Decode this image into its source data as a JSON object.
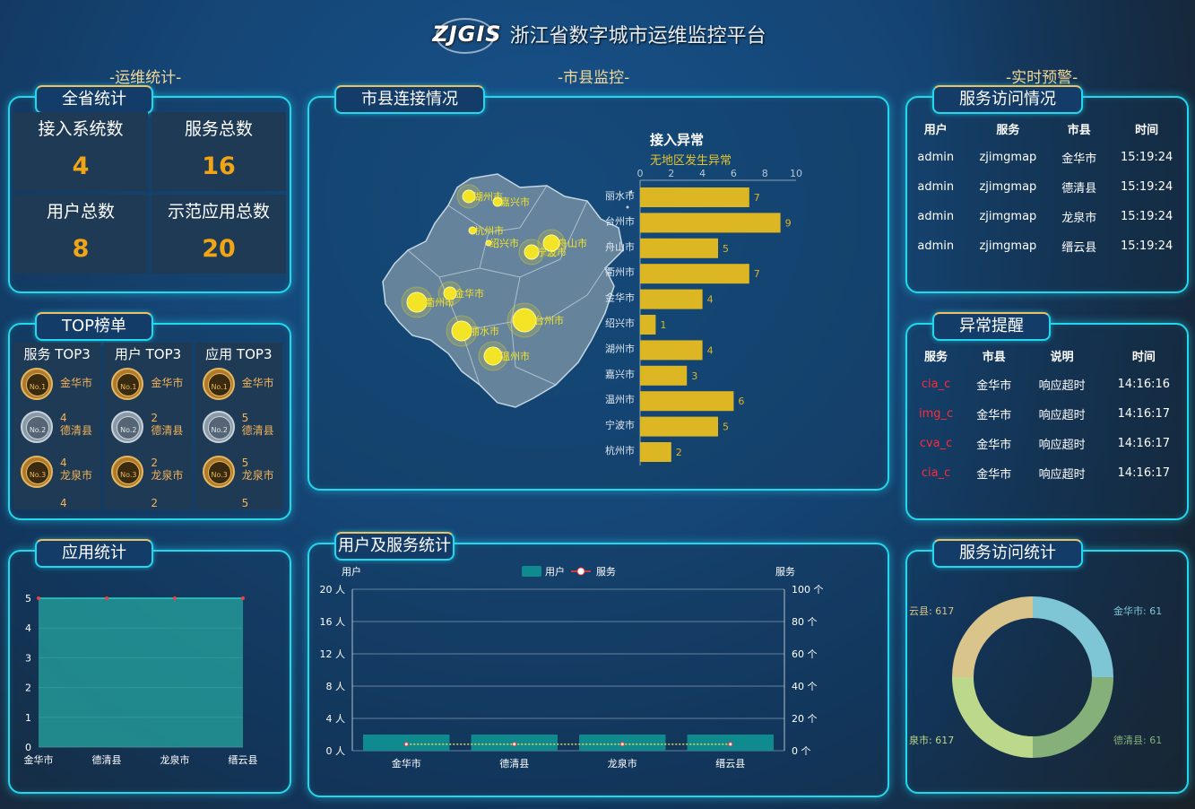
{
  "header": {
    "logo": "ZJGIS",
    "title": "浙江省数字城市运维监控平台"
  },
  "sections": {
    "ops": "-运维统计-",
    "city": "-市县监控-",
    "alert": "-实时预警-"
  },
  "province": {
    "title": "全省统计",
    "stats": [
      {
        "label": "接入系统数",
        "value": "4"
      },
      {
        "label": "服务总数",
        "value": "16"
      },
      {
        "label": "用户总数",
        "value": "8"
      },
      {
        "label": "示范应用总数",
        "value": "20"
      }
    ]
  },
  "top": {
    "title": "TOP榜单",
    "columns": [
      {
        "head": "服务 TOP3",
        "r1": "金华市",
        "r2_num": "4",
        "r2_name": "德清县",
        "r3_num": "4",
        "r3_name": "龙泉市",
        "footer": "4"
      },
      {
        "head": "用户 TOP3",
        "r1": "金华市",
        "r2_num": "2",
        "r2_name": "德清县",
        "r3_num": "2",
        "r3_name": "龙泉市",
        "footer": "2"
      },
      {
        "head": "应用 TOP3",
        "r1": "金华市",
        "r2_num": "5",
        "r2_name": "德清县",
        "r3_num": "5",
        "r3_name": "龙泉市",
        "footer": "5"
      }
    ],
    "medals": [
      "No.1",
      "No.2",
      "No.3"
    ]
  },
  "app_stats": {
    "title": "应用统计"
  },
  "connection": {
    "title": "市县连接情况",
    "chart_title": "接入异常",
    "chart_subtitle": "无地区发生异常",
    "map_cities": [
      {
        "name": "湖州市",
        "size": 7
      },
      {
        "name": "嘉兴市",
        "size": 5
      },
      {
        "name": "杭州市",
        "size": 4
      },
      {
        "name": "绍兴市",
        "size": 3
      },
      {
        "name": "宁波市",
        "size": 8
      },
      {
        "name": "舟山市",
        "size": 9
      },
      {
        "name": "金华市",
        "size": 7
      },
      {
        "name": "衢州市",
        "size": 11
      },
      {
        "name": "丽水市",
        "size": 11
      },
      {
        "name": "台州市",
        "size": 13
      },
      {
        "name": "温州市",
        "size": 10
      }
    ]
  },
  "user_service": {
    "title": "用户及服务统计"
  },
  "access": {
    "title": "服务访问情况",
    "headers": [
      "用户",
      "服务",
      "市县",
      "时间"
    ],
    "rows": [
      [
        "admin",
        "zjimgmap",
        "金华市",
        "15:19:24"
      ],
      [
        "admin",
        "zjimgmap",
        "德清县",
        "15:19:24"
      ],
      [
        "admin",
        "zjimgmap",
        "龙泉市",
        "15:19:24"
      ],
      [
        "admin",
        "zjimgmap",
        "缙云县",
        "15:19:24"
      ]
    ]
  },
  "alerts": {
    "title": "异常提醒",
    "headers": [
      "服务",
      "市县",
      "说明",
      "时间"
    ],
    "rows": [
      [
        "cia_c",
        "金华市",
        "响应超时",
        "14:16:16"
      ],
      [
        "img_c",
        "金华市",
        "响应超时",
        "14:16:17"
      ],
      [
        "cva_c",
        "金华市",
        "响应超时",
        "14:16:17"
      ],
      [
        "cia_c",
        "金华市",
        "响应超时",
        "14:16:17"
      ]
    ]
  },
  "visit_stats": {
    "title": "服务访问统计"
  },
  "colors": {
    "accent": "#23d7ee",
    "gold": "#f0a516",
    "bar": "#dcb623",
    "teal": "#0f8a8f"
  },
  "chart_data": [
    {
      "type": "bar",
      "orientation": "horizontal",
      "title": "接入异常",
      "subtitle": "无地区发生异常",
      "categories": [
        "丽水市",
        "台州市",
        "舟山市",
        "衢州市",
        "金华市",
        "绍兴市",
        "湖州市",
        "嘉兴市",
        "温州市",
        "宁波市",
        "杭州市"
      ],
      "values": [
        7,
        9,
        5,
        7,
        4,
        1,
        4,
        3,
        6,
        5,
        2
      ],
      "xlim": [
        0,
        10
      ],
      "xticks": [
        "0",
        "2",
        "4",
        "6",
        "8",
        "10"
      ]
    },
    {
      "type": "area",
      "categories": [
        "金华市",
        "德清县",
        "龙泉市",
        "缙云县"
      ],
      "values": [
        5,
        5,
        5,
        5
      ],
      "ylim": [
        0,
        5
      ],
      "yticks": [
        "0",
        "1",
        "2",
        "3",
        "4",
        "5"
      ]
    },
    {
      "type": "bar",
      "categories": [
        "金华市",
        "德清县",
        "龙泉市",
        "缙云县"
      ],
      "legend": [
        "用户",
        "服务"
      ],
      "y_left_label": "用户",
      "y_right_label": "服务",
      "y_left_ticks": [
        "0 人",
        "4 人",
        "8 人",
        "12 人",
        "16 人",
        "20 人"
      ],
      "y_right_ticks": [
        "0 个",
        "20 个",
        "40 个",
        "60 个",
        "80 个",
        "100 个"
      ],
      "series": [
        {
          "name": "用户",
          "type": "bar",
          "values": [
            2,
            2,
            2,
            2
          ],
          "ylim": [
            0,
            20
          ]
        },
        {
          "name": "服务",
          "type": "line",
          "values": [
            4,
            4,
            4,
            4
          ],
          "ylim": [
            0,
            100
          ]
        }
      ]
    },
    {
      "type": "pie",
      "variant": "donut",
      "slices": [
        {
          "label": "金华市: 61",
          "value": 61,
          "color": "#7ec6d6"
        },
        {
          "label": "德清县: 61",
          "value": 61,
          "color": "#86b07a"
        },
        {
          "label": "泉市: 617",
          "value": 617,
          "color": "#bcd88a"
        },
        {
          "label": "云县: 617",
          "value": 617,
          "color": "#d9c48c"
        }
      ]
    }
  ]
}
